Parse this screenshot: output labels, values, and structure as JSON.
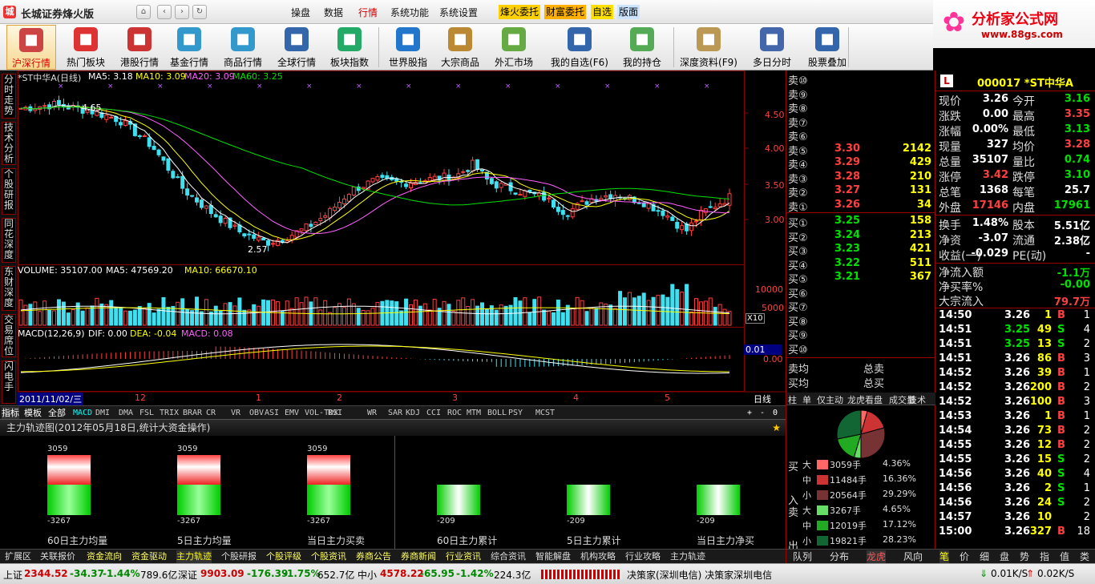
{
  "app": {
    "title": "长城证券烽火版",
    "home_icon": "home-icon"
  },
  "menus": [
    "操盘",
    "数据",
    "行情",
    "系统功能",
    "系统设置"
  ],
  "active_menu": "行情",
  "highlights": [
    "烽火委托",
    "财富委托",
    "自选",
    "版面"
  ],
  "brand": {
    "title": "分析家公式网",
    "url": "www.88gs.com"
  },
  "toolbar": [
    {
      "label": "沪深行情",
      "icon": "chart-icon",
      "color": "#c44"
    },
    {
      "label": "热门板块",
      "icon": "rocket-icon",
      "color": "#d33"
    },
    {
      "label": "港股行情",
      "icon": "hk-chart-icon",
      "color": "#c33"
    },
    {
      "label": "基金行情",
      "icon": "fund-icon",
      "color": "#39c"
    },
    {
      "label": "商品行情",
      "icon": "commodity-icon",
      "color": "#39c"
    },
    {
      "label": "全球行情",
      "icon": "globe-icon",
      "color": "#36a"
    },
    {
      "label": "板块指数",
      "icon": "blocks-icon",
      "color": "#2a6"
    },
    {
      "label": "世界股指",
      "icon": "world-icon",
      "color": "#27c"
    },
    {
      "label": "大宗商品",
      "icon": "box-icon",
      "color": "#b83"
    },
    {
      "label": "外汇市场",
      "icon": "money-icon",
      "color": "#6a4"
    },
    {
      "label": "我的自选(F6)",
      "icon": "user-icon",
      "color": "#36a"
    },
    {
      "label": "我的持仓",
      "icon": "clock-icon",
      "color": "#5a5"
    },
    {
      "label": "深度资料(F9)",
      "icon": "folder-icon",
      "color": "#b95"
    },
    {
      "label": "多日分时",
      "icon": "calendar-icon",
      "color": "#46a"
    },
    {
      "label": "股票叠加",
      "icon": "stack-icon",
      "color": "#36a"
    }
  ],
  "side_tabs": [
    "分时走势",
    "技术分析",
    "个股研报",
    "同花深度",
    "东财深度",
    "交易席位",
    "闪电手"
  ],
  "kline": {
    "title": "*ST中华A(日线)",
    "ma5": "MA5: 3.18",
    "ma10": "MA10: 3.09",
    "ma20": "MA20: 3.09",
    "ma60": "MA60: 3.25",
    "y_ticks": [
      "4.50",
      "4.00",
      "3.50",
      "3.00"
    ],
    "high_mark": "4.65",
    "low_mark": "2.57"
  },
  "volume": {
    "label": "VOLUME: 35107.00",
    "ma5": "MA5: 47569.20",
    "ma10": "MA10: 66670.10",
    "y_ticks": [
      "10000",
      "5000"
    ],
    "unit": "X10"
  },
  "macd": {
    "label": "MACD(12,26,9)",
    "dif": "DIF: 0.00",
    "dea": "DEA: -0.04",
    "macd": "MACD: 0.08",
    "value": "0.01",
    "zero": "0.00"
  },
  "x_axis": {
    "date": "2011/11/02/三",
    "ticks": [
      "12",
      "1",
      "2",
      "3",
      "4",
      "5"
    ],
    "period": "日线"
  },
  "indicators": [
    "指标",
    "模板",
    "全部",
    "MACD",
    "DMI",
    "DMA",
    "FSL",
    "TRIX",
    "BRAR",
    "CR",
    "VR",
    "OBV",
    "ASI",
    "EMV",
    "VOL-TDX",
    "RSI",
    "WR",
    "SAR",
    "KDJ",
    "CCI",
    "ROC",
    "MTM",
    "BOLL",
    "PSY",
    "MCST"
  ],
  "order_book": {
    "sells": [
      {
        "label": "卖⑩",
        "price": "",
        "vol": ""
      },
      {
        "label": "卖⑨",
        "price": "",
        "vol": ""
      },
      {
        "label": "卖⑧",
        "price": "",
        "vol": ""
      },
      {
        "label": "卖⑦",
        "price": "",
        "vol": ""
      },
      {
        "label": "卖⑥",
        "price": "",
        "vol": ""
      },
      {
        "label": "卖⑤",
        "price": "3.30",
        "vol": "2142"
      },
      {
        "label": "卖④",
        "price": "3.29",
        "vol": "429"
      },
      {
        "label": "卖③",
        "price": "3.28",
        "vol": "210"
      },
      {
        "label": "卖②",
        "price": "3.27",
        "vol": "131"
      },
      {
        "label": "卖①",
        "price": "3.26",
        "vol": "34"
      }
    ],
    "buys": [
      {
        "label": "买①",
        "price": "3.25",
        "vol": "158"
      },
      {
        "label": "买②",
        "price": "3.24",
        "vol": "213"
      },
      {
        "label": "买③",
        "price": "3.23",
        "vol": "421"
      },
      {
        "label": "买④",
        "price": "3.22",
        "vol": "511"
      },
      {
        "label": "买⑤",
        "price": "3.21",
        "vol": "367"
      },
      {
        "label": "买⑥",
        "price": "",
        "vol": ""
      },
      {
        "label": "买⑦",
        "price": "",
        "vol": ""
      },
      {
        "label": "买⑧",
        "price": "",
        "vol": ""
      },
      {
        "label": "买⑨",
        "price": "",
        "vol": ""
      },
      {
        "label": "买⑩",
        "price": "",
        "vol": ""
      }
    ],
    "avg_sell": "卖均",
    "avg_buy": "买均",
    "total_sell": "总卖",
    "total_buy": "总买"
  },
  "right_tabs": [
    "柱",
    "单",
    "仅主动",
    "龙虎看盘",
    "成交量",
    "技术"
  ],
  "stock": {
    "code": "000017 *ST中华A",
    "badge": "L"
  },
  "quote": [
    [
      "现价",
      "3.26",
      "今开",
      "3.16"
    ],
    [
      "涨跌",
      "0.00",
      "最高",
      "3.35"
    ],
    [
      "涨幅",
      "0.00%",
      "最低",
      "3.13"
    ],
    [
      "现量",
      "327",
      "均价",
      "3.28"
    ],
    [
      "总量",
      "35107",
      "量比",
      "0.74"
    ],
    [
      "涨停",
      "3.42",
      "跌停",
      "3.10"
    ],
    [
      "总笔",
      "1368",
      "每笔",
      "25.7"
    ],
    [
      "外盘",
      "17146",
      "内盘",
      "17961"
    ],
    [
      "换手",
      "1.48%",
      "股本",
      "5.51亿"
    ],
    [
      "净资",
      "-3.07",
      "流通",
      "2.38亿"
    ],
    [
      "收益(一)",
      "-0.029",
      "PE(动)",
      "-"
    ],
    [
      "净流入额",
      "",
      "",
      "-1.1万"
    ],
    [
      "净买率%",
      "",
      "",
      "-0.00"
    ],
    [
      "大宗流入",
      "",
      "",
      "79.7万"
    ]
  ],
  "ticks": [
    [
      "14:50",
      "3.26",
      "1",
      "B",
      "1"
    ],
    [
      "14:51",
      "3.25",
      "49",
      "S",
      "4"
    ],
    [
      "14:51",
      "3.25",
      "13",
      "S",
      "2"
    ],
    [
      "14:51",
      "3.26",
      "86",
      "B",
      "3"
    ],
    [
      "14:52",
      "3.26",
      "39",
      "B",
      "1"
    ],
    [
      "14:52",
      "3.26",
      "200",
      "B",
      "2"
    ],
    [
      "14:52",
      "3.26",
      "100",
      "B",
      "3"
    ],
    [
      "14:53",
      "3.26",
      "1",
      "B",
      "1"
    ],
    [
      "14:54",
      "3.26",
      "73",
      "B",
      "2"
    ],
    [
      "14:55",
      "3.26",
      "12",
      "B",
      "2"
    ],
    [
      "14:55",
      "3.26",
      "15",
      "S",
      "2"
    ],
    [
      "14:56",
      "3.26",
      "40",
      "S",
      "4"
    ],
    [
      "14:56",
      "3.26",
      "2",
      "S",
      "1"
    ],
    [
      "14:56",
      "3.26",
      "24",
      "S",
      "2"
    ],
    [
      "14:57",
      "3.26",
      "10",
      "",
      "2"
    ],
    [
      "15:00",
      "3.26",
      "327",
      "B",
      "18"
    ]
  ],
  "fund": {
    "title": "主力轨迹图(2012年05月18日,统计大资金操作)",
    "bars": [
      {
        "top": "3059",
        "bot": "-3267",
        "cap": "60日主力均量",
        "red": true
      },
      {
        "top": "3059",
        "bot": "-3267",
        "cap": "5日主力均量",
        "red": true
      },
      {
        "top": "3059",
        "bot": "-3267",
        "cap": "当日主力买卖",
        "red": true
      },
      {
        "top": "",
        "bot": "-209",
        "cap": "60日主力累计",
        "red": false
      },
      {
        "top": "",
        "bot": "-209",
        "cap": "5日主力累计",
        "red": false
      },
      {
        "top": "",
        "bot": "-209",
        "cap": "当日主力净买",
        "red": false
      }
    ]
  },
  "distribution": {
    "rows": [
      {
        "side": "买",
        "size": "大",
        "hands": "3059手",
        "pct": "4.36%",
        "color": "#f66"
      },
      {
        "side": "",
        "size": "中",
        "hands": "11484手",
        "pct": "16.36%",
        "color": "#c33"
      },
      {
        "side": "入",
        "size": "小",
        "hands": "20564手",
        "pct": "29.29%",
        "color": "#733"
      },
      {
        "side": "卖",
        "size": "大",
        "hands": "3267手",
        "pct": "4.65%",
        "color": "#6d6"
      },
      {
        "side": "",
        "size": "中",
        "hands": "12019手",
        "pct": "17.12%",
        "color": "#2a2"
      },
      {
        "side": "出",
        "size": "小",
        "hands": "19821手",
        "pct": "28.23%",
        "color": "#163"
      }
    ],
    "tabs": [
      "队列",
      "分布",
      "龙虎",
      "风向"
    ],
    "pie": [
      4.36,
      16.36,
      29.29,
      4.65,
      17.12,
      28.23
    ]
  },
  "bottom_nav": [
    "扩展区",
    "关联报价",
    "资金流向",
    "资金驱动",
    "主力轨迹",
    "个股研报",
    "个股评级",
    "个股资讯",
    "券商公告",
    "券商新闻",
    "行业资讯",
    "综合资讯",
    "智能解盘",
    "机构攻略",
    "行业攻略",
    "主力轨迹"
  ],
  "right_bottom_tabs": [
    "笔",
    "价",
    "细",
    "盘",
    "势",
    "指",
    "值",
    "类"
  ],
  "status": {
    "sh_label": "上证",
    "sh_val": "2344.52",
    "sh_chg": "-34.37",
    "sh_pct": "-1.44%",
    "sh_amt": "789.6亿",
    "sz_label": "深证",
    "sz_val": "9903.09",
    "sz_chg": "-176.39",
    "sz_pct": "-1.75%",
    "sz_amt": "652.7亿",
    "zx_label": "中小",
    "zx_val": "4578.22",
    "zx_chg": "-65.95",
    "zx_pct": "-1.42%",
    "zx_amt": "224.3亿",
    "server": "决策家(深圳电信) 决策家深圳电信",
    "down": "0.01K/S",
    "up": "0.02K/S"
  },
  "kline_chart": {
    "low": 2.57,
    "high": 4.65
  }
}
